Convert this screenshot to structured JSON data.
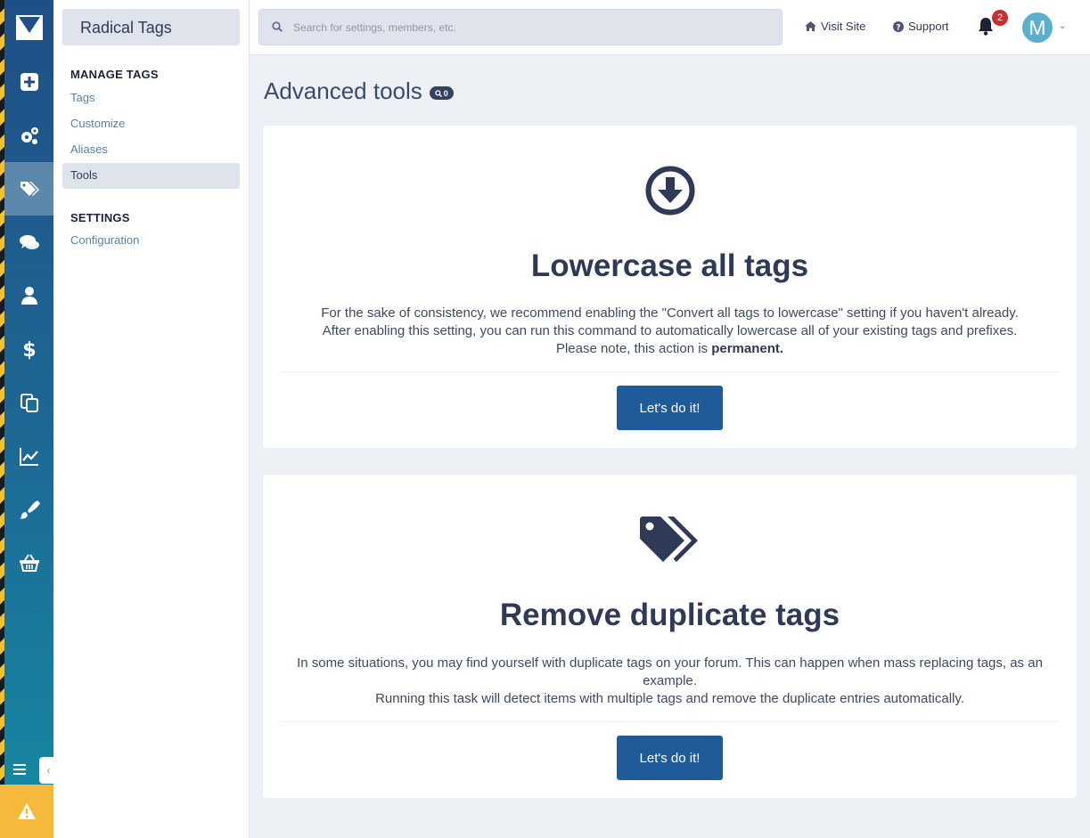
{
  "rail": {
    "items": [
      {
        "icon": "plus-square-icon"
      },
      {
        "icon": "gears-icon"
      },
      {
        "icon": "tags-icon",
        "active": true
      },
      {
        "icon": "comments-icon"
      },
      {
        "icon": "user-icon"
      },
      {
        "icon": "dollar-icon"
      },
      {
        "icon": "copy-icon"
      },
      {
        "icon": "line-chart-icon"
      },
      {
        "icon": "paint-brush-icon"
      },
      {
        "icon": "basket-icon"
      }
    ],
    "collapse_glyph": "‹"
  },
  "subnav": {
    "title": "Radical Tags",
    "sections": [
      {
        "heading": "MANAGE TAGS",
        "links": [
          "Tags",
          "Customize",
          "Aliases",
          "Tools"
        ]
      },
      {
        "heading": "SETTINGS",
        "links": [
          "Configuration"
        ]
      }
    ],
    "active_link": "Tools"
  },
  "topbar": {
    "search_placeholder": "Search for settings, members, etc.",
    "visit_site": "Visit Site",
    "support": "Support",
    "notification_count": "2",
    "avatar_letter": "M"
  },
  "main": {
    "title": "Advanced tools",
    "title_pill_count": "0",
    "cards": [
      {
        "heading": "Lowercase all tags",
        "desc_lines": [
          "For the sake of consistency, we recommend enabling the \"Convert all tags to lowercase\" setting if you haven't already.",
          "After enabling this setting, you can run this command to automatically lowercase all of your existing tags and prefixes."
        ],
        "desc_note": "Please note, this action is ",
        "desc_bold": "permanent.",
        "button": "Let's do it!"
      },
      {
        "heading": "Remove duplicate tags",
        "desc_lines": [
          "In some situations, you may find yourself with duplicate tags on your forum. This can happen when mass replacing tags, as an example.",
          "Running this task will detect items with multiple tags and remove the duplicate entries automatically."
        ],
        "button": "Let's do it!"
      }
    ]
  },
  "colors": {
    "rail_top": "#1f4f86",
    "rail_bottom": "#158ba3",
    "accent_button": "#1f5b99",
    "badge": "#c62f2f",
    "warning": "#f6b93b"
  }
}
